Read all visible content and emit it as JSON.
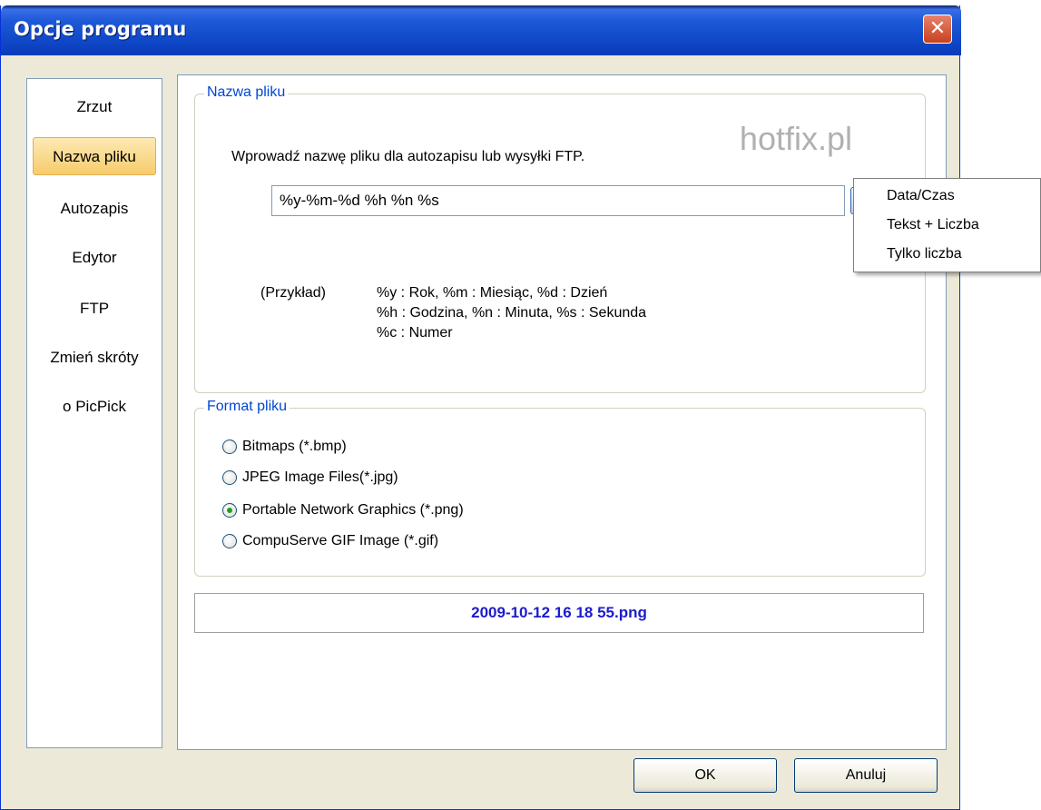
{
  "window": {
    "title": "Opcje programu",
    "close_symbol": "✕"
  },
  "sidebar": {
    "items": [
      {
        "label": "Zrzut"
      },
      {
        "label": "Nazwa pliku",
        "active": true
      },
      {
        "label": "Autozapis"
      },
      {
        "label": "Edytor"
      },
      {
        "label": "FTP"
      },
      {
        "label": "Zmień skróty"
      },
      {
        "label": "o PicPick"
      }
    ]
  },
  "filename_group": {
    "legend": "Nazwa pliku",
    "prompt": "Wprowadź nazwę pliku dla autozapisu lub wysyłki FTP.",
    "watermark": "hotfix.pl",
    "input_value": "%y-%m-%d %h %n %s",
    "example_label": "(Przykład)",
    "example_lines": [
      "%y : Rok, %m : Miesiąc, %d : Dzień",
      "%h : Godzina, %n : Minuta, %s : Sekunda",
      "%c : Numer"
    ]
  },
  "format_group": {
    "legend": "Format pliku",
    "options": [
      {
        "label": "Bitmaps (*.bmp)",
        "checked": false
      },
      {
        "label": "JPEG Image Files(*.jpg)",
        "checked": false
      },
      {
        "label": "Portable Network Graphics (*.png)",
        "checked": true
      },
      {
        "label": "CompuServe GIF Image (*.gif)",
        "checked": false
      }
    ]
  },
  "preview": {
    "text": "2009-10-12 16 18 55.png"
  },
  "buttons": {
    "ok": "OK",
    "cancel": "Anuluj"
  },
  "dropdown_menu": {
    "items": [
      {
        "label": "Data/Czas"
      },
      {
        "label": "Tekst + Liczba"
      },
      {
        "label": "Tylko liczba"
      }
    ]
  },
  "colors": {
    "legend": "#0046d5",
    "preview_text": "#1c1ccc",
    "active_item": "#f7cc6b",
    "radio_checked": "#21a121"
  }
}
